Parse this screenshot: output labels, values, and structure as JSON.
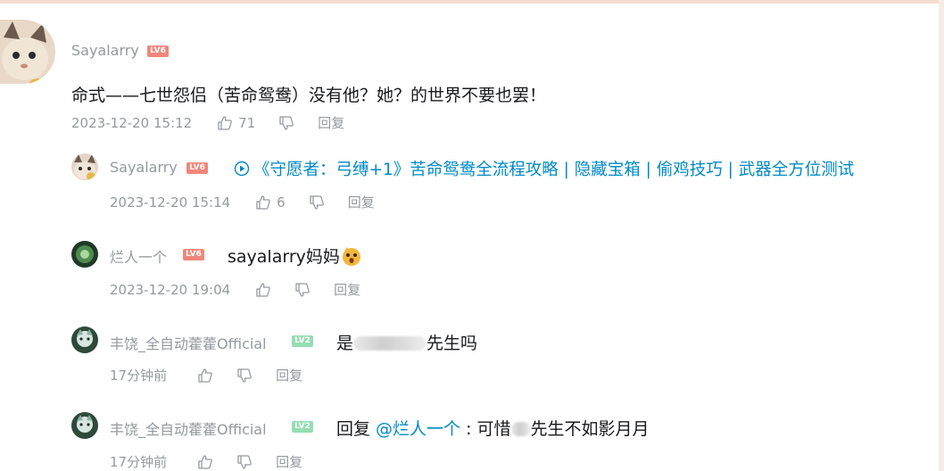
{
  "comments": [
    {
      "user": "Sayalarry",
      "level": "LV6",
      "text": "命式——七世怨侣（苦命鸳鸯）没有他？她？的世界不要也罢！",
      "time": "2023-12-20 15:12",
      "likes": "71",
      "reply_label": "回复"
    },
    {
      "user": "Sayalarry",
      "level": "LV6",
      "link_text": "《守愿者：弓缚+1》苦命鸳鸯全流程攻略 | 隐藏宝箱 | 偷鸡技巧 | 武器全方位测试",
      "time": "2023-12-20 15:14",
      "likes": "6",
      "reply_label": "回复"
    },
    {
      "user": "烂人一个",
      "level": "LV6",
      "text": "sayalarry妈妈",
      "time": "2023-12-20 19:04",
      "reply_label": "回复"
    },
    {
      "user": "丰饶_全自动藿藿Official",
      "level": "LV2",
      "text_before": "是",
      "text_after": "先生吗",
      "time": "17分钟前",
      "reply_label": "回复"
    },
    {
      "user": "丰饶_全自动藿藿Official",
      "level": "LV2",
      "reply_prefix": "回复 ",
      "mention": "@烂人一个",
      "text_before": " : 可惜",
      "text_after": "先生不如影月月",
      "time": "17分钟前",
      "reply_label": "回复"
    }
  ],
  "colors": {
    "link": "#008ac5",
    "meta": "#9499a0",
    "level_red": "#f2867a",
    "level_green": "#95ddb2"
  },
  "icons": [
    "thumb-up-icon",
    "thumb-down-icon",
    "play-circle-icon",
    "shocked-emoji-icon"
  ]
}
